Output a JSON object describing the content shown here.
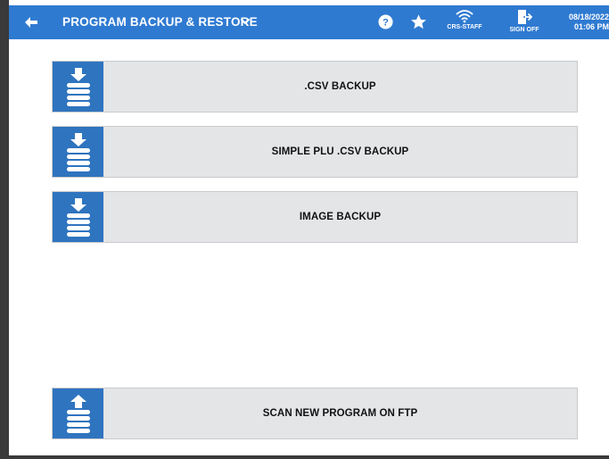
{
  "header": {
    "title": "PROGRAM BACKUP & RESTORE",
    "wifi_label": "CRS-STAFF",
    "signoff_label": "SIGN OFF",
    "date": "08/18/2022",
    "time": "01:06 PM",
    "background_color": "#2f7ad1"
  },
  "actions": [
    {
      "label": ".CSV BACKUP",
      "icon": "database-download-icon"
    },
    {
      "label": "SIMPLE PLU .CSV BACKUP",
      "icon": "database-download-icon"
    },
    {
      "label": "IMAGE BACKUP",
      "icon": "database-download-icon"
    },
    {
      "label": "SCAN NEW PROGRAM ON FTP",
      "icon": "database-upload-icon"
    }
  ],
  "colors": {
    "icon_box": "#2f74bf",
    "button_bg": "#e3e5e7"
  }
}
